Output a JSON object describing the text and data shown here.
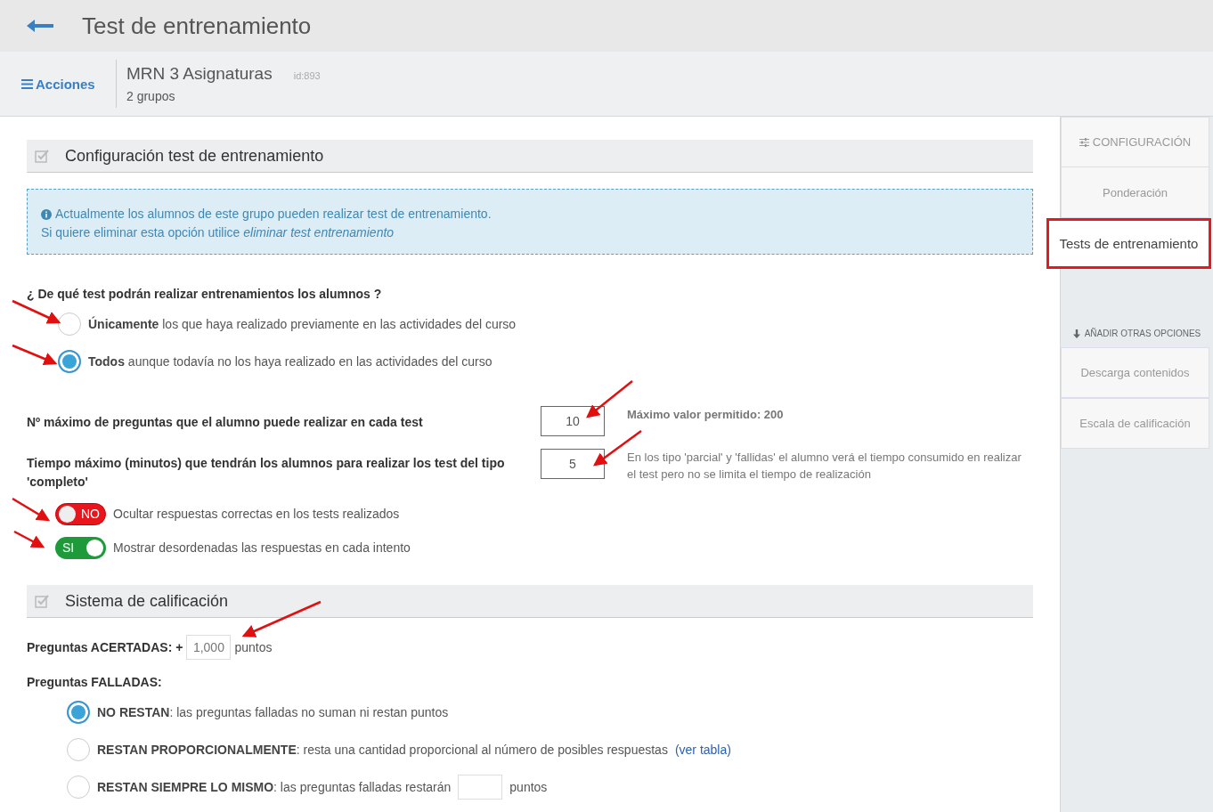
{
  "header": {
    "title": "Test de entrenamiento"
  },
  "course_bar": {
    "actions": "Acciones",
    "name": "MRN 3 Asignaturas",
    "id": "id:893",
    "groups": "2 grupos"
  },
  "config_section": {
    "title": "Configuración test de entrenamiento",
    "info": [
      "Actualmente los alumnos de este grupo pueden realizar test de entrenamiento.",
      "Si quiere eliminar esta opción utilice *eliminar test entrenamiento*"
    ],
    "question": "¿ De qué test podrán realizar entrenamientos los alumnos ?",
    "test_options": [
      {
        "label": "**Únicamente** los que haya realizado previamente en las actividades del curso",
        "selected": false
      },
      {
        "label": "**Todos** aunque todavía no los haya realizado en las actividades del curso",
        "selected": true
      }
    ],
    "numeric_fields": [
      {
        "label": "Nº máximo de preguntas que el alumno puede realizar en cada test",
        "value": "10",
        "hint": "Máximo valor permitido: 200"
      },
      {
        "label": "Tiempo máximo (minutos) que tendrán los alumnos para realizar los test del tipo 'completo'",
        "value": "5",
        "hint": "En los tipo 'parcial' y 'fallidas' el alumno verá el tiempo consumido en realizar el test pero no se limita el tiempo de realización"
      }
    ],
    "toggles": [
      {
        "label": "Ocultar respuestas correctas en los tests realizados",
        "on": false,
        "state_text": "NO"
      },
      {
        "label": "Mostrar desordenadas las respuestas en cada intento",
        "on": true,
        "state_text": "SI"
      }
    ]
  },
  "grading_section": {
    "title": "Sistema de calificación",
    "correct": {
      "label": "Preguntas ACERTADAS: +",
      "value": "1,000",
      "unit": "puntos"
    },
    "wrong_label": "Preguntas FALLADAS:",
    "wrong_options": [
      {
        "kind": "plain",
        "label": "**NO RESTAN**: las preguntas falladas no suman ni restan puntos",
        "selected": true
      },
      {
        "kind": "link",
        "label": "**RESTAN PROPORCIONALMENTE**: resta una cantidad proporcional al número de posibles respuestas",
        "link": "(ver tabla)",
        "selected": false
      },
      {
        "kind": "field",
        "label": "**RESTAN SIEMPRE LO MISMO**: las preguntas falladas restarán",
        "unit": "puntos",
        "selected": false
      }
    ]
  },
  "sidebar": {
    "heading": "CONFIGURACIÓN",
    "items": [
      {
        "label": "Ponderación",
        "selected": false
      },
      {
        "label": "Tests de entrenamiento",
        "selected": true
      }
    ],
    "more_heading": "AÑADIR OTRAS OPCIONES",
    "more_items": [
      {
        "label": "Descarga contenidos"
      },
      {
        "label": "Escala de calificación"
      }
    ]
  }
}
